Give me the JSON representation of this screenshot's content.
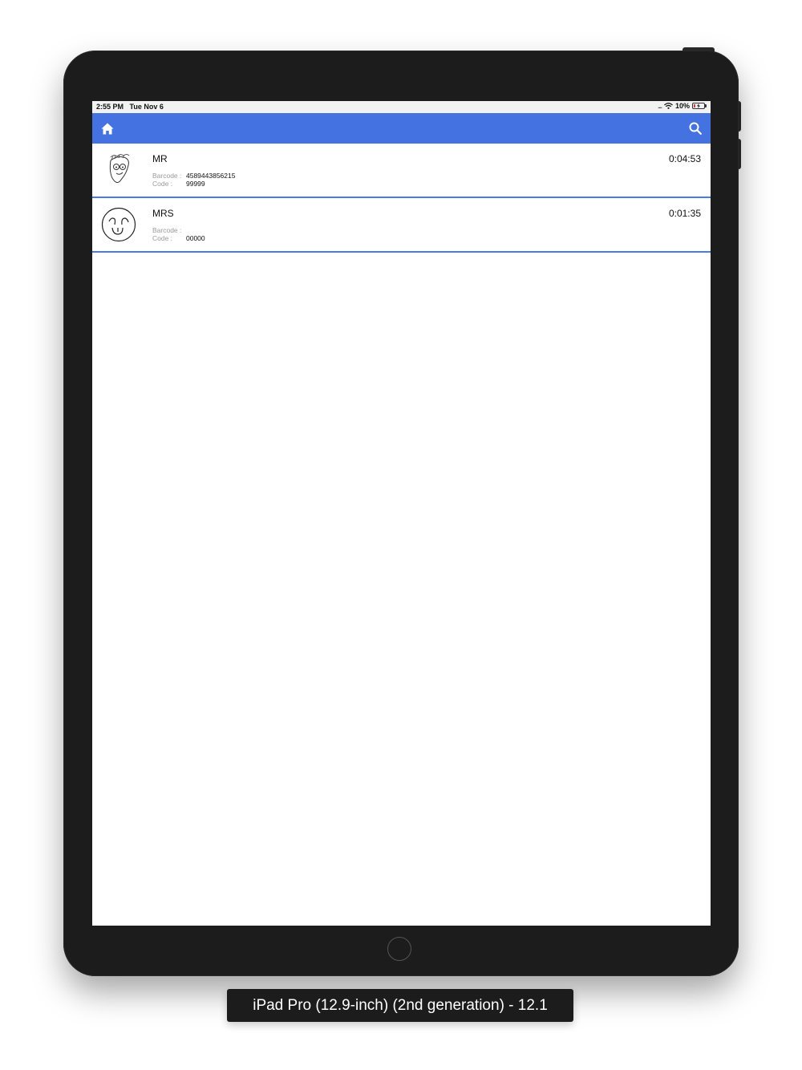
{
  "status_bar": {
    "time": "2:55 PM",
    "date": "Tue Nov 6",
    "battery": "10%",
    "signal": "....",
    "wifi_icon": "wifi-icon",
    "battery_icon": "battery-charging-icon"
  },
  "nav": {
    "home_icon": "home-icon",
    "search_icon": "search-icon",
    "bar_color": "#4472e0"
  },
  "rows": [
    {
      "title": "MR",
      "time": "0:04:53",
      "barcode_label": "Barcode :",
      "barcode_value": "4589443856215",
      "code_label": "Code :",
      "code_value": "99999",
      "avatar_icon": "signature-face-icon"
    },
    {
      "title": "MRS",
      "time": "0:01:35",
      "barcode_label": "Barcode :",
      "barcode_value": "",
      "code_label": "Code :",
      "code_value": "00000",
      "avatar_icon": "smiley-face-icon"
    }
  ],
  "device": {
    "label": "iPad Pro (12.9-inch) (2nd generation) - 12.1",
    "home_button_icon": "home-button-icon"
  }
}
